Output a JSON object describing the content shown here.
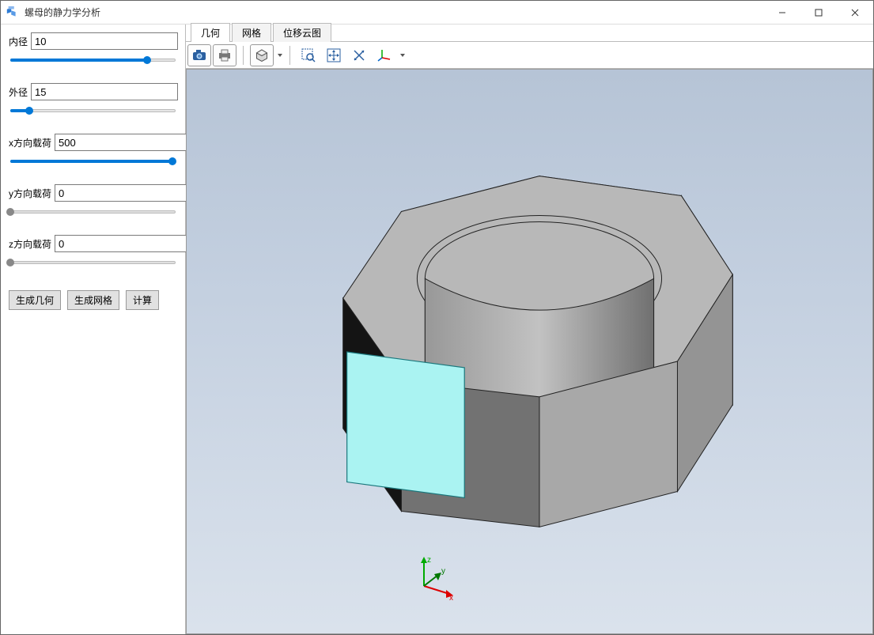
{
  "window": {
    "title": "螺母的静力学分析"
  },
  "sidebar": {
    "params": [
      {
        "label": "内径",
        "value": "10",
        "pct": 82
      },
      {
        "label": "外径",
        "value": "15",
        "pct": 12
      },
      {
        "label": "x方向载荷",
        "value": "500",
        "pct": 97
      },
      {
        "label": "y方向载荷",
        "value": "0",
        "pct": 1
      },
      {
        "label": "z方向载荷",
        "value": "0",
        "pct": 1
      }
    ],
    "buttons": {
      "gen_geom": "生成几何",
      "gen_mesh": "生成网格",
      "compute": "计算"
    }
  },
  "tabs": {
    "geometry": "几何",
    "mesh": "网格",
    "displacement": "位移云图",
    "active": 0
  },
  "axis": {
    "x": "x",
    "y": "y",
    "z": "z"
  }
}
